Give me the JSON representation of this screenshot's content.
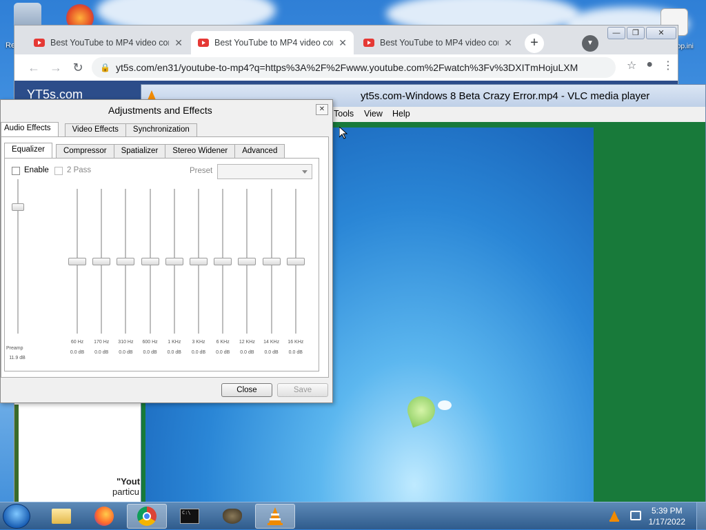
{
  "desktop": {
    "icons": [
      {
        "name": "recycle-bin",
        "label": "Re"
      },
      {
        "name": "firefox",
        "label": ""
      },
      {
        "name": "file",
        "label": "desktop.ini"
      }
    ]
  },
  "chrome": {
    "tabs": [
      {
        "title": "Best YouTube to MP4 video conv",
        "close": "✕"
      },
      {
        "title": "Best YouTube to MP4 video conv",
        "close": "✕"
      },
      {
        "title": "Best YouTube to MP4 video conv",
        "close": "✕"
      }
    ],
    "new_tab": "+",
    "url": "yt5s.com/en31/youtube-to-mp4?q=https%3A%2F%2Fwww.youtube.com%2Fwatch%3Fv%3DXITmHojuLXM",
    "site_logo": "YT5s.com",
    "page_text_bold": "\"Yout",
    "page_text": "particu",
    "window_buttons": [
      "—",
      "❐",
      "✕"
    ]
  },
  "vlc": {
    "title": "yt5s.com-Windows 8 Beta Crazy Error.mp4 - VLC media player",
    "menu": [
      "Tools",
      "View",
      "Help"
    ],
    "colors": {
      "background": "#187a3a"
    }
  },
  "adjustments": {
    "title": "Adjustments and Effects",
    "close": "✕",
    "outer_tabs": [
      "Audio Effects",
      "Video Effects",
      "Synchronization"
    ],
    "inner_tabs": [
      "Equalizer",
      "Compressor",
      "Spatializer",
      "Stereo Widener",
      "Advanced"
    ],
    "enable_label": "Enable",
    "two_pass_label": "2 Pass",
    "preset_label": "Preset",
    "preset_value": "",
    "preamp": {
      "label": "Preamp",
      "value": "11.9 dB",
      "level": 0.82
    },
    "bands": [
      {
        "freq": "60 Hz",
        "value": "0.0 dB"
      },
      {
        "freq": "170 Hz",
        "value": "0.0 dB"
      },
      {
        "freq": "310 Hz",
        "value": "0.0 dB"
      },
      {
        "freq": "600 Hz",
        "value": "0.0 dB"
      },
      {
        "freq": "1 KHz",
        "value": "0.0 dB"
      },
      {
        "freq": "3 KHz",
        "value": "0.0 dB"
      },
      {
        "freq": "6 KHz",
        "value": "0.0 dB"
      },
      {
        "freq": "12 KHz",
        "value": "0.0 dB"
      },
      {
        "freq": "14 KHz",
        "value": "0.0 dB"
      },
      {
        "freq": "16 KHz",
        "value": "0.0 dB"
      }
    ],
    "close_button": "Close",
    "save_button": "Save"
  },
  "taskbar": {
    "apps": [
      "file-explorer",
      "firefox",
      "chrome",
      "command-prompt",
      "gimp",
      "vlc"
    ],
    "time": "5:39 PM",
    "date": "1/17/2022"
  }
}
